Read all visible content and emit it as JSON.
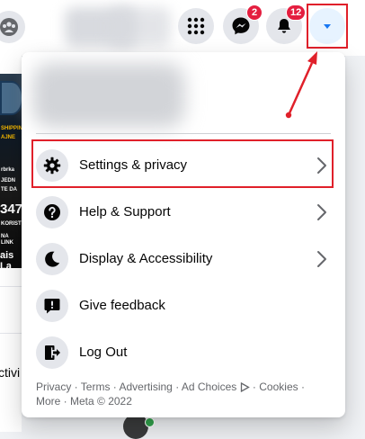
{
  "topbar": {
    "messenger_badge": "2",
    "notifications_badge": "12"
  },
  "background": {
    "post_lines": [
      "SHIPPING",
      "AJNE",
      "rbrka",
      "JEDN",
      "TE DA",
      "KORISTI",
      "NA LINK"
    ],
    "post_big": "347",
    "post_bottom": "ais La",
    "left_word": "ctivi"
  },
  "menu": {
    "items": [
      {
        "label": "Settings & privacy",
        "icon": "gear-icon",
        "has_chevron": true
      },
      {
        "label": "Help & Support",
        "icon": "question-icon",
        "has_chevron": true
      },
      {
        "label": "Display & Accessibility",
        "icon": "moon-icon",
        "has_chevron": true
      },
      {
        "label": "Give feedback",
        "icon": "feedback-icon",
        "has_chevron": false
      },
      {
        "label": "Log Out",
        "icon": "logout-icon",
        "has_chevron": false
      }
    ],
    "footer": {
      "privacy": "Privacy",
      "terms": "Terms",
      "advertising": "Advertising",
      "ad_choices": "Ad Choices",
      "cookies": "Cookies",
      "more": "More",
      "meta": "Meta © 2022",
      "sep": " · "
    }
  },
  "colors": {
    "accent": "#1877f2",
    "annotation_red": "#e0202a",
    "badge_red": "#e41e3f",
    "online_green": "#31a24c"
  }
}
